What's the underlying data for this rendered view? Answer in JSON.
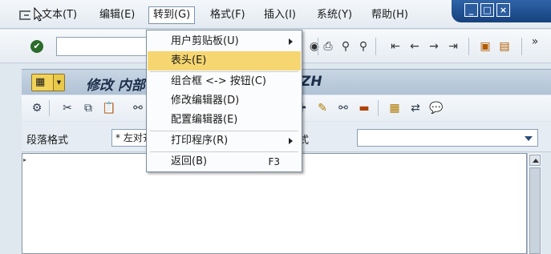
{
  "menubar": {
    "items": [
      {
        "label": "文本(T)"
      },
      {
        "label": "编辑(E)"
      },
      {
        "label": "转到(G)"
      },
      {
        "label": "格式(F)"
      },
      {
        "label": "插入(I)"
      },
      {
        "label": "系统(Y)"
      },
      {
        "label": "帮助(H)"
      }
    ]
  },
  "window": {
    "minimize_glyph": "_",
    "maximize_glyph": "□",
    "close_glyph": "×"
  },
  "toolbar1": {
    "enter_glyph": "✔",
    "command_value": "",
    "overflow_glyph": "»"
  },
  "title": {
    "text_left": "修改 内部",
    "text_right": "ZH"
  },
  "format": {
    "paragraph_label": "段落格式",
    "paragraph_value": "* 左对齐",
    "char_label": "式",
    "char_value": ""
  },
  "dropdown": {
    "items": [
      {
        "label": "用户剪贴板(U)",
        "has_submenu": true,
        "shortcut": ""
      },
      {
        "label": "表头(E)",
        "highlighted": true,
        "shortcut": ""
      },
      {
        "label": "组合框 <-> 按钮(C)",
        "shortcut": ""
      },
      {
        "label": "修改编辑器(D)",
        "shortcut": ""
      },
      {
        "label": "配置编辑器(E)",
        "shortcut": ""
      },
      {
        "label": "打印程序(R)",
        "has_submenu": true,
        "shortcut": ""
      },
      {
        "label": "返回(B)",
        "shortcut": "F3"
      }
    ]
  },
  "editor": {
    "marker_glyph": "▸"
  }
}
